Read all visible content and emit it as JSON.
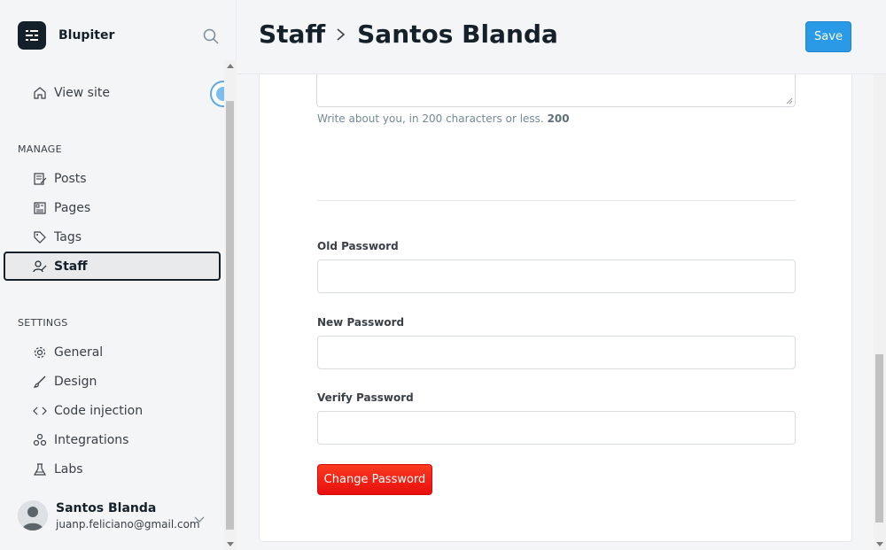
{
  "brand": {
    "name": "Blupiter"
  },
  "sidebar": {
    "view_site": "View site",
    "manage_title": "MANAGE",
    "manage_items": [
      {
        "label": "Posts",
        "icon": "posts-icon"
      },
      {
        "label": "Pages",
        "icon": "pages-icon"
      },
      {
        "label": "Tags",
        "icon": "tag-icon"
      },
      {
        "label": "Staff",
        "icon": "staff-icon",
        "active": true
      }
    ],
    "settings_title": "SETTINGS",
    "settings_items": [
      {
        "label": "General",
        "icon": "gear-icon"
      },
      {
        "label": "Design",
        "icon": "brush-icon"
      },
      {
        "label": "Code injection",
        "icon": "code-icon"
      },
      {
        "label": "Integrations",
        "icon": "integrations-icon"
      },
      {
        "label": "Labs",
        "icon": "flask-icon"
      }
    ]
  },
  "user": {
    "name": "Santos Blanda",
    "email": "juanp.feliciano@gmail.com"
  },
  "header": {
    "crumb_parent": "Staff",
    "crumb_current": "Santos Blanda",
    "save_label": "Save"
  },
  "form": {
    "bio_hint": "Write about you, in 200 characters or less.",
    "bio_count": "200",
    "old_password_label": "Old Password",
    "new_password_label": "New Password",
    "verify_password_label": "Verify Password",
    "old_password_value": "",
    "new_password_value": "",
    "verify_password_value": "",
    "change_password_label": "Change Password"
  },
  "colors": {
    "accent": "#2b9ae6",
    "danger": "#f50b23",
    "text": "#15212a"
  }
}
